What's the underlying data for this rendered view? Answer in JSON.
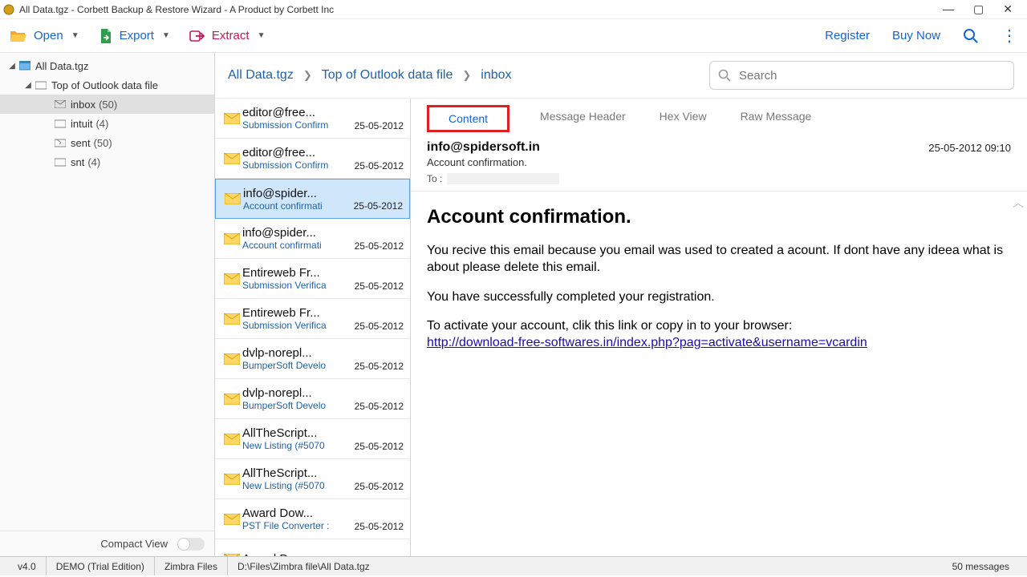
{
  "window": {
    "title": "All Data.tgz - Corbett Backup & Restore Wizard - A Product by Corbett Inc"
  },
  "toolbar": {
    "open": "Open",
    "export": "Export",
    "extract": "Extract",
    "register": "Register",
    "buy_now": "Buy Now"
  },
  "tree": {
    "root": {
      "label": "All Data.tgz"
    },
    "outlook": {
      "label": "Top of Outlook data file"
    },
    "items": [
      {
        "label": "inbox",
        "count": "(50)",
        "icon": "envelope"
      },
      {
        "label": "intuit",
        "count": "(4)",
        "icon": "folder"
      },
      {
        "label": "sent",
        "count": "(50)",
        "icon": "sent"
      },
      {
        "label": "snt",
        "count": "(4)",
        "icon": "folder"
      }
    ],
    "compact": "Compact View"
  },
  "breadcrumbs": [
    "All Data.tgz",
    "Top of Outlook data file",
    "inbox"
  ],
  "search_placeholder": "Search",
  "messages": [
    {
      "from": "editor@free...",
      "subject": "Submission Confirm",
      "date": "25-05-2012"
    },
    {
      "from": "editor@free...",
      "subject": "Submission Confirm",
      "date": "25-05-2012"
    },
    {
      "from": "info@spider...",
      "subject": "Account confirmati",
      "date": "25-05-2012",
      "selected": true
    },
    {
      "from": "info@spider...",
      "subject": "Account confirmati",
      "date": "25-05-2012"
    },
    {
      "from": "Entireweb Fr...",
      "subject": "Submission Verifica",
      "date": "25-05-2012"
    },
    {
      "from": "Entireweb Fr...",
      "subject": "Submission Verifica",
      "date": "25-05-2012"
    },
    {
      "from": "dvlp-norepl...",
      "subject": "BumperSoft Develo",
      "date": "25-05-2012"
    },
    {
      "from": "dvlp-norepl...",
      "subject": "BumperSoft Develo",
      "date": "25-05-2012"
    },
    {
      "from": "AllTheScript...",
      "subject": "New Listing (#5070",
      "date": "25-05-2012"
    },
    {
      "from": "AllTheScript...",
      "subject": "New Listing (#5070",
      "date": "25-05-2012"
    },
    {
      "from": "Award Dow...",
      "subject": "PST File Converter :",
      "date": "25-05-2012"
    },
    {
      "from": "Award Dow...",
      "subject": "",
      "date": ""
    }
  ],
  "tabs": {
    "content": "Content",
    "message_header": "Message Header",
    "hex_view": "Hex View",
    "raw_message": "Raw Message"
  },
  "preview": {
    "from": "info@spidersoft.in",
    "subject": "Account confirmation.",
    "to_label": "To :",
    "datetime": "25-05-2012 09:10",
    "heading": "Account confirmation.",
    "para1": "You recive this email because you email was used to created a acount. If dont have any ideea what is about please delete this email.",
    "para2": "You have successfully completed your registration.",
    "para3_prefix": "To activate your account, clik this link or copy in to your browser:",
    "link": "http://download-free-softwares.in/index.php?pag=activate&username=vcardin"
  },
  "status": {
    "version": "v4.0",
    "edition": "DEMO (Trial Edition)",
    "profile": "Zimbra Files",
    "path": "D:\\Files\\Zimbra file\\All Data.tgz",
    "count": "50  messages"
  }
}
